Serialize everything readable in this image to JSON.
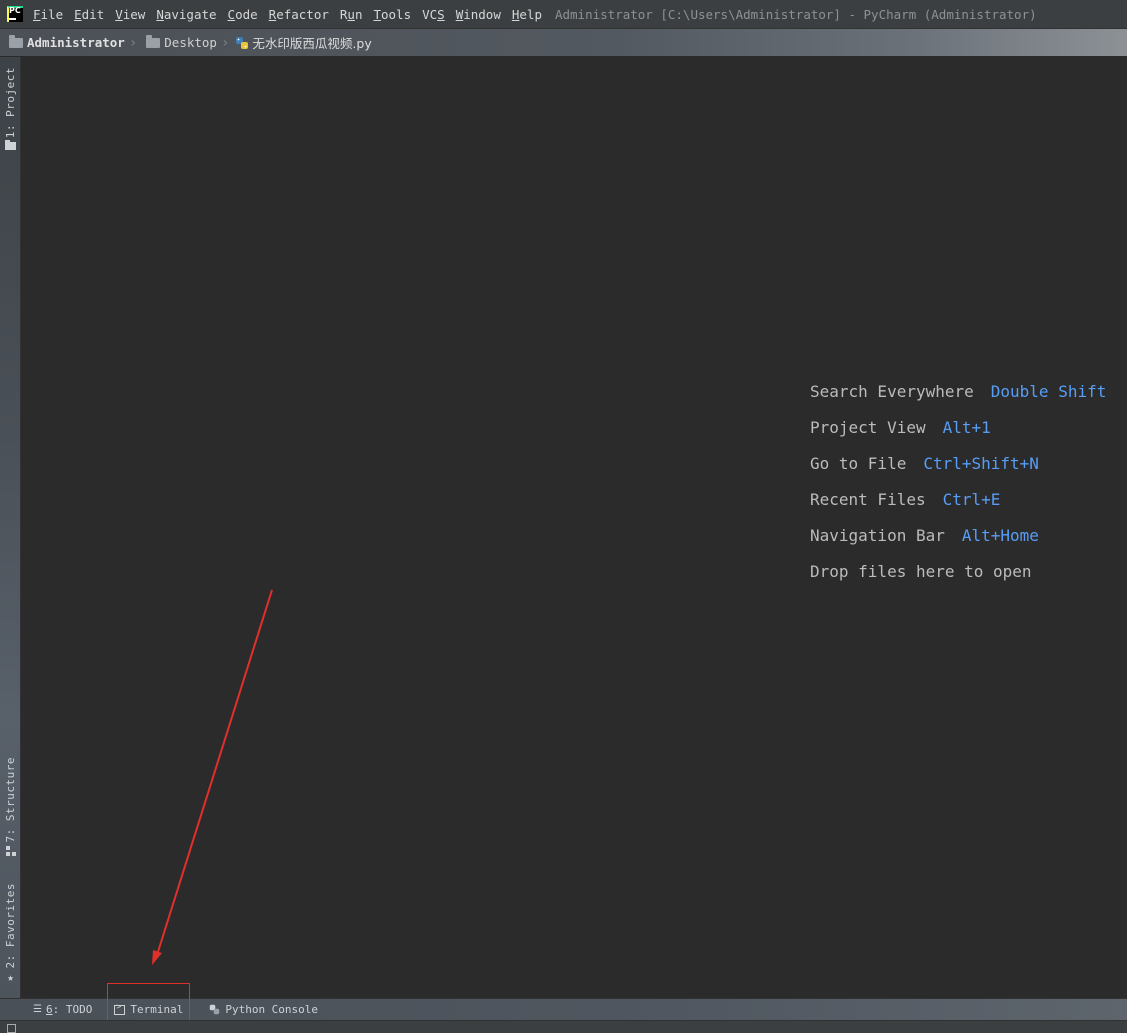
{
  "menu": {
    "items": [
      {
        "ul": "F",
        "rest": "ile"
      },
      {
        "ul": "E",
        "rest": "dit"
      },
      {
        "ul": "V",
        "rest": "iew"
      },
      {
        "ul": "N",
        "rest": "avigate"
      },
      {
        "ul": "C",
        "rest": "ode"
      },
      {
        "ul": "R",
        "rest": "efactor"
      },
      {
        "pre": "R",
        "ul": "u",
        "rest": "n"
      },
      {
        "ul": "T",
        "rest": "ools"
      },
      {
        "pre": "VC",
        "ul": "S",
        "rest": ""
      },
      {
        "ul": "W",
        "rest": "indow"
      },
      {
        "ul": "H",
        "rest": "elp"
      }
    ],
    "window_title": "Administrator [C:\\Users\\Administrator] - PyCharm (Administrator)",
    "logo_text": "PC"
  },
  "breadcrumb": {
    "items": [
      "Administrator",
      "Desktop"
    ],
    "file": "无水印版西瓜视频.py"
  },
  "left_strip": {
    "project": "1: Project",
    "structure": "7: Structure",
    "favorites": "2: Favorites"
  },
  "hints": [
    {
      "label": "Search Everywhere",
      "key": "Double Shift"
    },
    {
      "label": "Project View",
      "key": "Alt+1"
    },
    {
      "label": "Go to File",
      "key": "Ctrl+Shift+N"
    },
    {
      "label": "Recent Files",
      "key": "Ctrl+E"
    },
    {
      "label": "Navigation Bar",
      "key": "Alt+Home"
    },
    {
      "label": "Drop files here to open",
      "key": ""
    }
  ],
  "bottom_tabs": {
    "todo_num": "6",
    "todo_label": ": TODO",
    "terminal": "Terminal",
    "python_console": "Python Console"
  },
  "colors": {
    "annotation_red": "#e0302c",
    "shortcut_blue": "#589df6"
  }
}
